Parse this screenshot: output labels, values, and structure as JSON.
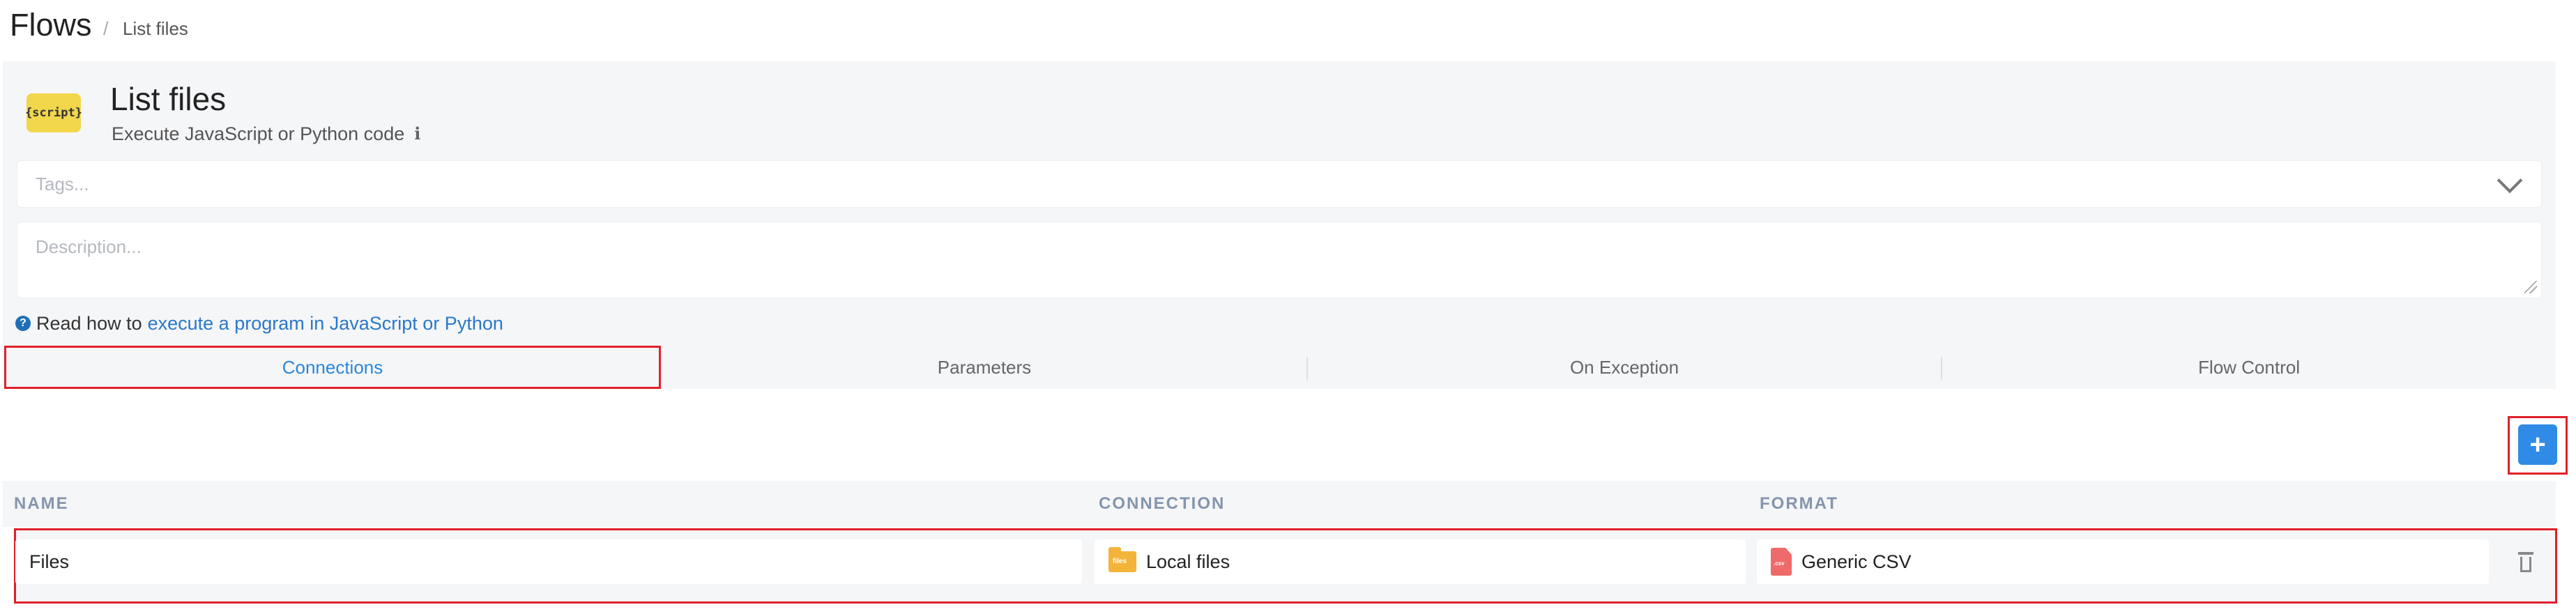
{
  "breadcrumb": {
    "root": "Flows",
    "separator": "/",
    "current": "List files"
  },
  "step": {
    "badge": "{script}",
    "title": "List files",
    "subtitle": "Execute JavaScript or Python code",
    "info_icon": "info-icon"
  },
  "tags": {
    "placeholder": "Tags..."
  },
  "description": {
    "placeholder": "Description..."
  },
  "help": {
    "prefix": "Read how to",
    "link": "execute a program in JavaScript or Python"
  },
  "tabs": [
    {
      "label": "Connections",
      "active": true
    },
    {
      "label": "Parameters",
      "active": false
    },
    {
      "label": "On Exception",
      "active": false
    },
    {
      "label": "Flow Control",
      "active": false
    }
  ],
  "add_button": {
    "label": "+"
  },
  "table": {
    "headers": {
      "name": "NAME",
      "connection": "CONNECTION",
      "format": "FORMAT"
    },
    "rows": [
      {
        "name": "Files",
        "connection": "Local files",
        "connection_icon_text": "files",
        "format": "Generic CSV",
        "format_icon_text": ".csv"
      }
    ]
  },
  "colors": {
    "accent": "#2a86d8",
    "highlight": "#e0202a",
    "badge": "#f2d64b"
  }
}
